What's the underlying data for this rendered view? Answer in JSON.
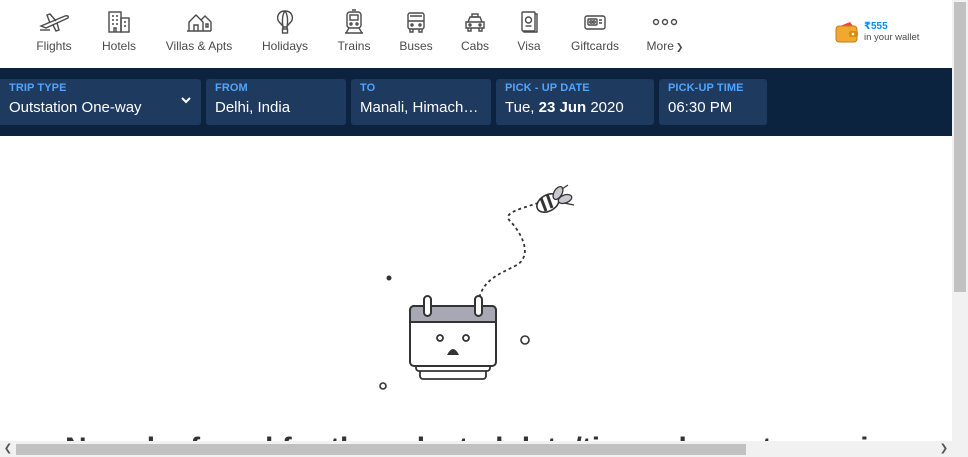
{
  "nav": {
    "items": [
      {
        "label": "Flights",
        "icon": "airplane-icon"
      },
      {
        "label": "Hotels",
        "icon": "hotel-building-icon"
      },
      {
        "label": "Villas & Apts",
        "icon": "villa-house-icon"
      },
      {
        "label": "Holidays",
        "icon": "hot-air-balloon-icon"
      },
      {
        "label": "Trains",
        "icon": "train-icon"
      },
      {
        "label": "Buses",
        "icon": "bus-icon"
      },
      {
        "label": "Cabs",
        "icon": "cab-icon"
      },
      {
        "label": "Visa",
        "icon": "passport-icon"
      },
      {
        "label": "Giftcards",
        "icon": "giftcard-icon"
      },
      {
        "label": "More",
        "icon": "more-dots-icon"
      }
    ]
  },
  "wallet": {
    "amount": "₹555",
    "subtitle": "in your wallet"
  },
  "search": {
    "trip_type": {
      "label": "TRIP TYPE",
      "value": "Outstation One-way"
    },
    "from": {
      "label": "FROM",
      "value": "Delhi, India"
    },
    "to": {
      "label": "TO",
      "value": "Manali, Himachal Pradesh"
    },
    "pickup_date": {
      "label": "PICK - UP DATE",
      "weekday": "Tue,",
      "day_month": "23 Jun",
      "year": "2020"
    },
    "pickup_time": {
      "label": "PICK-UP TIME",
      "value": "06:30 PM"
    }
  },
  "main": {
    "empty_message": "No cabs found for the selected date/time, please try again"
  },
  "colors": {
    "searchbar_bg": "#0c2340",
    "field_bg": "#1f3a5f",
    "field_label": "#4fa5ff",
    "wallet_amount": "#008cff"
  }
}
